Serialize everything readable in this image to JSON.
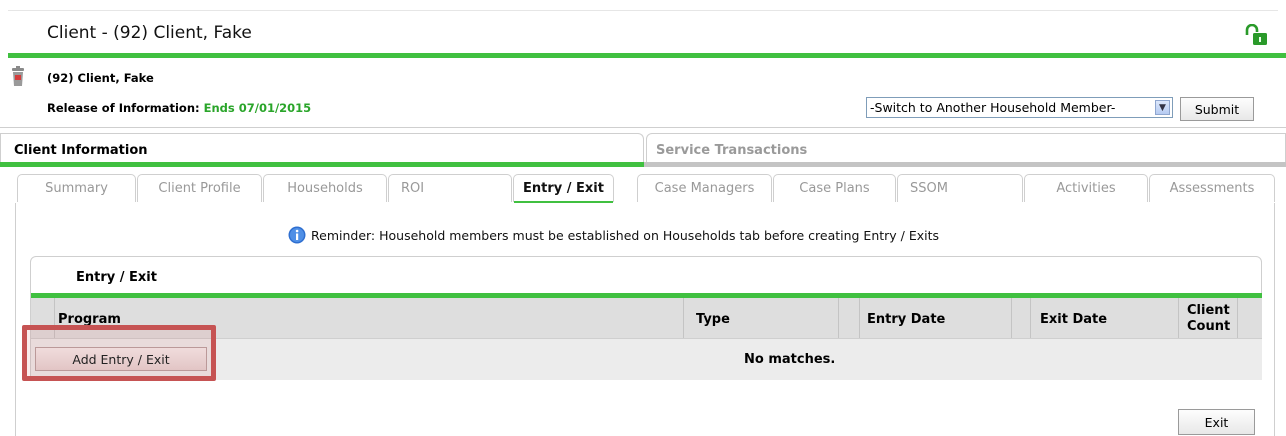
{
  "header": {
    "title": "Client - (92) Client, Fake",
    "client_name": "(92) Client, Fake",
    "roi_label": "Release of Information:",
    "roi_value": "Ends 07/01/2015",
    "switch_member_selected": "-Switch to Another Household Member-",
    "submit_label": "Submit"
  },
  "main_tabs": [
    {
      "label": "Client Information",
      "active": true
    },
    {
      "label": "Service Transactions",
      "active": false
    }
  ],
  "sub_tabs": [
    {
      "label": "Summary"
    },
    {
      "label": "Client Profile"
    },
    {
      "label": "Households"
    },
    {
      "label": "ROI"
    },
    {
      "label": "Entry / Exit",
      "active": true
    },
    {
      "label": "Case Managers"
    },
    {
      "label": "Case Plans"
    },
    {
      "label": "SSOM"
    },
    {
      "label": "Activities"
    },
    {
      "label": "Assessments"
    }
  ],
  "reminder": "Reminder: Household members must be established on Households tab before creating Entry / Exits",
  "entry_exit": {
    "heading": "Entry / Exit",
    "columns": [
      "Program",
      "Type",
      "Entry Date",
      "Exit Date",
      "Client Count"
    ],
    "client_count_line1": "Client",
    "client_count_line2": "Count",
    "add_button": "Add Entry / Exit",
    "empty_message": "No matches."
  },
  "exit_label": "Exit",
  "colors": {
    "accent_green": "#40c040",
    "roi_green": "#2aa52a",
    "highlight_red": "#c65353"
  },
  "icons": [
    "lock-open-icon",
    "trash-can-icon",
    "info-icon",
    "dropdown-arrow-icon"
  ]
}
